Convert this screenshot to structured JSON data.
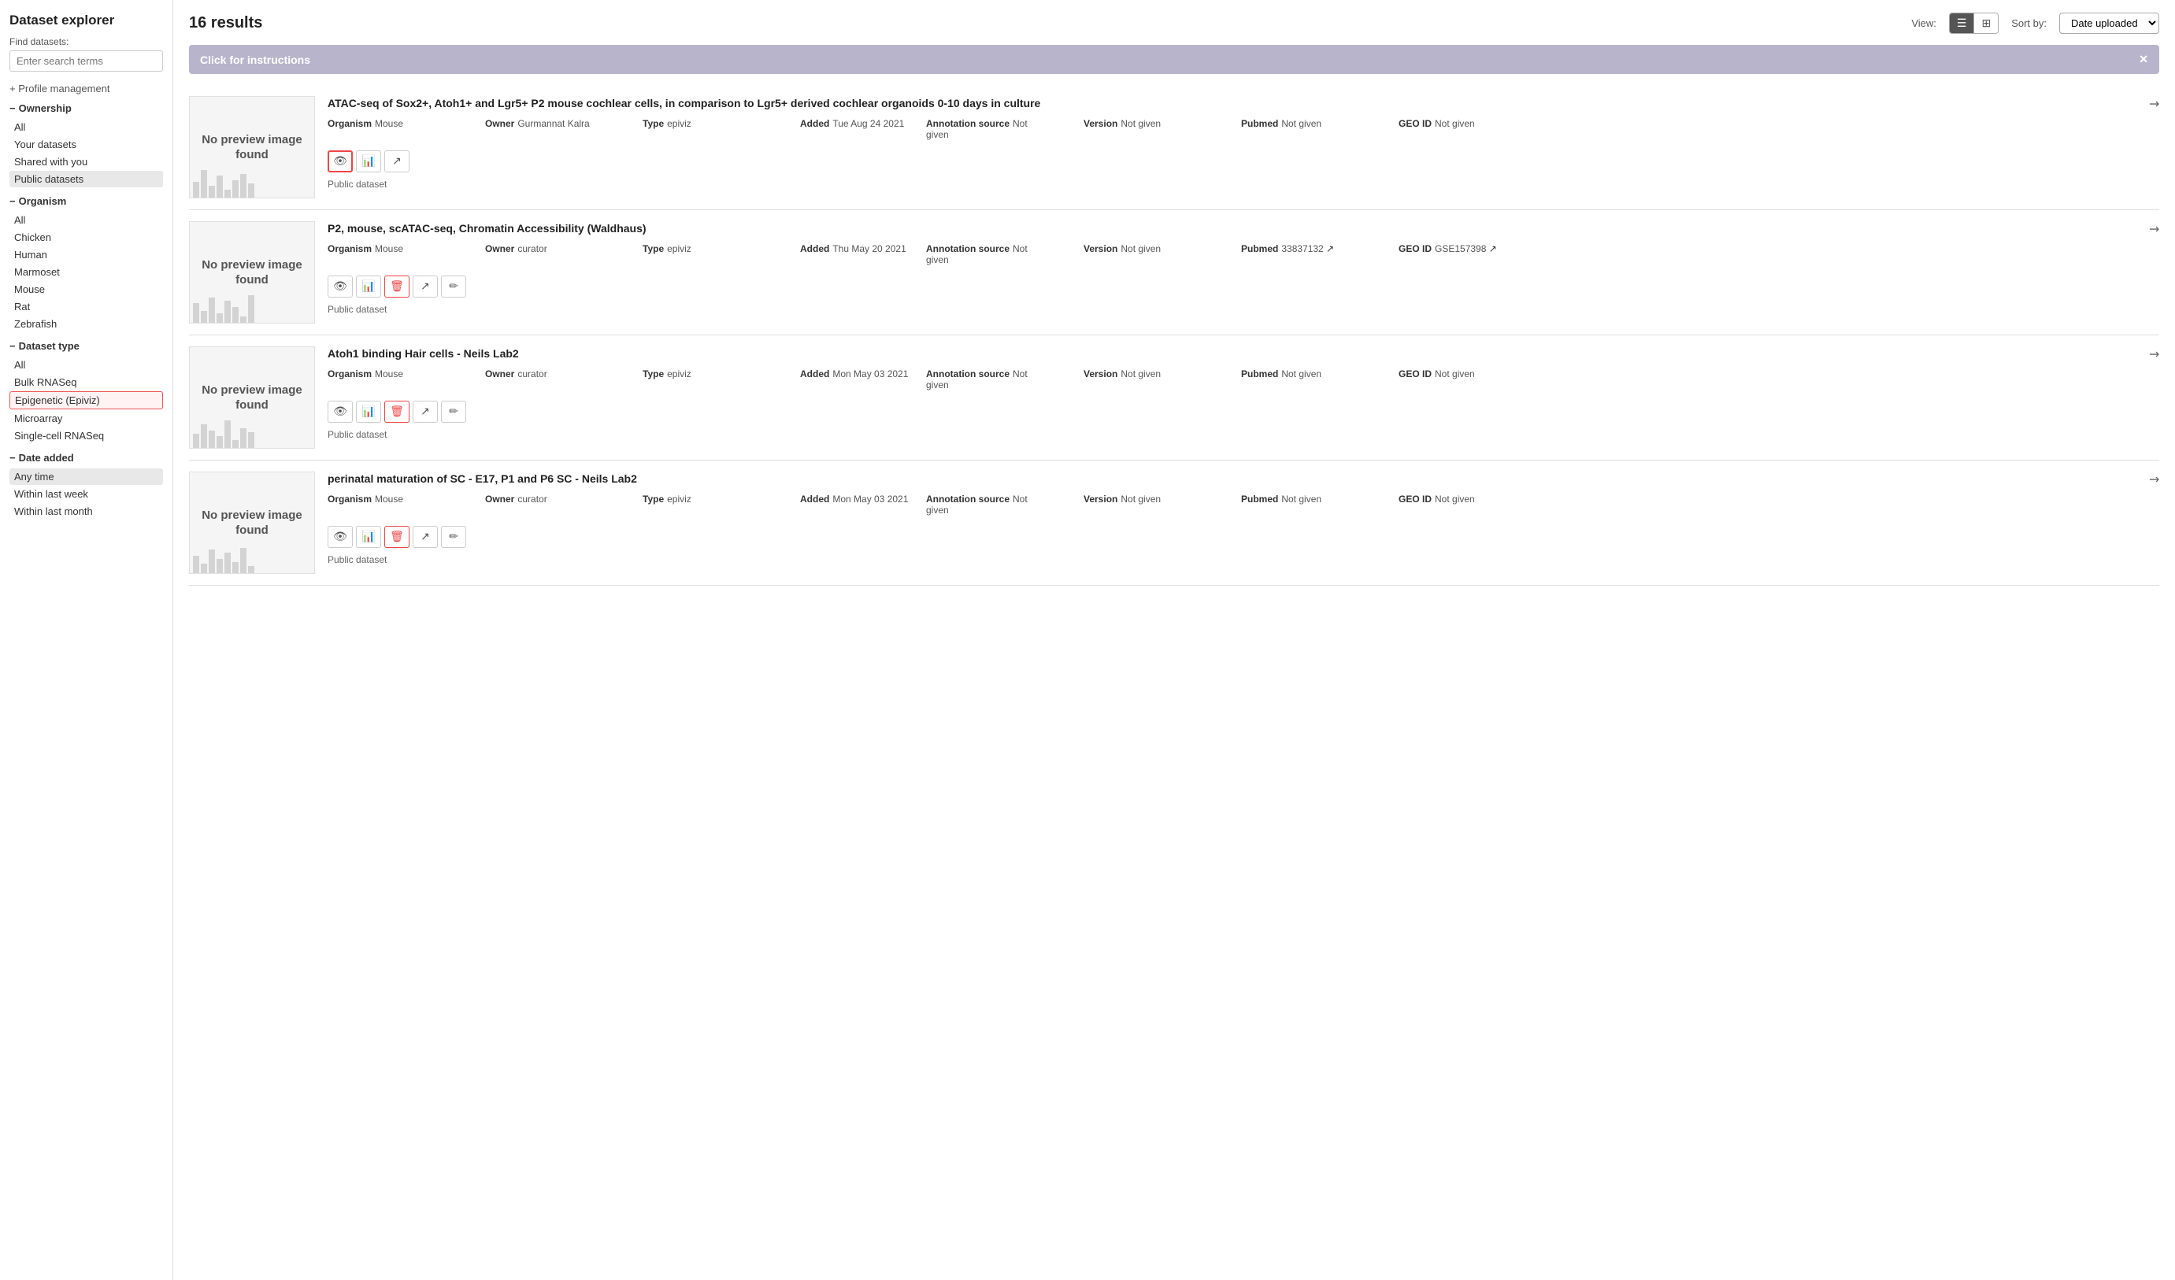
{
  "sidebar": {
    "title": "Dataset explorer",
    "find_label": "Find datasets:",
    "search_placeholder": "Enter search terms",
    "profile_management": "+ Profile management",
    "sections": {
      "ownership": {
        "label": "Ownership",
        "items": [
          "All",
          "Your datasets",
          "Shared with you",
          "Public datasets"
        ]
      },
      "organism": {
        "label": "Organism",
        "items": [
          "All",
          "Chicken",
          "Human",
          "Marmoset",
          "Mouse",
          "Rat",
          "Zebrafish"
        ]
      },
      "dataset_type": {
        "label": "Dataset type",
        "items": [
          "All",
          "Bulk RNASeq",
          "Epigenetic (Epiviz)",
          "Microarray",
          "Single-cell RNASeq"
        ]
      },
      "date_added": {
        "label": "Date added",
        "items": [
          "Any time",
          "Within last week",
          "Within last month"
        ]
      }
    },
    "active_ownership": "Public datasets",
    "active_dataset_type": "Epigenetic (Epiviz)",
    "active_date_added": "Any time"
  },
  "main": {
    "results_count": "16 results",
    "view_label": "View:",
    "sort_label": "Sort by:",
    "sort_option": "Date uploaded",
    "instructions_banner": "Click for instructions",
    "instructions_close": "✕",
    "datasets": [
      {
        "title": "ATAC-seq of Sox2+, Atoh1+ and Lgr5+ P2 mouse cochlear cells, in comparison to Lgr5+ derived cochlear organoids 0-10 days in culture",
        "organism": "Mouse",
        "owner": "Gurmannat Kalra",
        "type": "epiviz",
        "added": "Tue Aug 24 2021",
        "annotation_source": "Not given",
        "version": "Not given",
        "pubmed": "Not given",
        "geo_id": "Not given",
        "footer": "Public dataset",
        "actions": [
          "eye",
          "bar-chart",
          "share"
        ],
        "preview_text": "No preview image found",
        "highlight_eye": true
      },
      {
        "title": "P2, mouse, scATAC-seq, Chromatin Accessibility (Waldhaus)",
        "organism": "Mouse",
        "owner": "curator",
        "type": "epiviz",
        "added": "Thu May 20 2021",
        "annotation_source": "Not given",
        "version": "Not given",
        "pubmed": "33837132",
        "geo_id": "GSE157398",
        "footer": "Public dataset",
        "actions": [
          "eye",
          "bar-chart",
          "trash",
          "share",
          "edit"
        ],
        "preview_text": "No preview image found",
        "highlight_eye": false
      },
      {
        "title": "Atoh1 binding Hair cells - Neils Lab2",
        "organism": "Mouse",
        "owner": "curator",
        "type": "epiviz",
        "added": "Mon May 03 2021",
        "annotation_source": "Not given",
        "version": "Not given",
        "pubmed": "Not given",
        "geo_id": "Not given",
        "footer": "Public dataset",
        "actions": [
          "eye",
          "bar-chart",
          "trash",
          "share",
          "edit"
        ],
        "preview_text": "No preview image found",
        "highlight_eye": false
      },
      {
        "title": "perinatal maturation of SC - E17, P1 and P6 SC - Neils Lab2",
        "organism": "Mouse",
        "owner": "curator",
        "type": "epiviz",
        "added": "Mon May 03 2021",
        "annotation_source": "Not given",
        "version": "Not given",
        "pubmed": "Not given",
        "geo_id": "Not given",
        "footer": "Public dataset",
        "actions": [
          "eye",
          "bar-chart",
          "trash",
          "share",
          "edit"
        ],
        "preview_text": "No preview image found",
        "highlight_eye": false
      }
    ]
  }
}
